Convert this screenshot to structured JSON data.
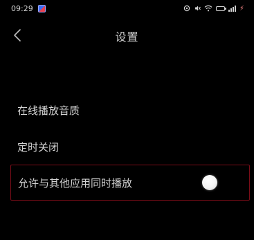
{
  "status_bar": {
    "time": "09:29",
    "app_icon": "app-badge-icon",
    "icons": [
      "alarm-icon",
      "mute-icon",
      "wifi-icon",
      "battery-icon",
      "signal-icon",
      "charging-icon"
    ],
    "charge_text": "⚡"
  },
  "header": {
    "back_icon": "chevron-left-icon",
    "title": "设置"
  },
  "settings": {
    "items": [
      {
        "label": "在线播放音质"
      },
      {
        "label": "定时关闭"
      },
      {
        "label": "允许与其他应用同时播放",
        "toggle": "off"
      }
    ]
  },
  "colors": {
    "background": "#000000",
    "text": "#d4d4d4",
    "highlight_border": "#7a0d18"
  }
}
